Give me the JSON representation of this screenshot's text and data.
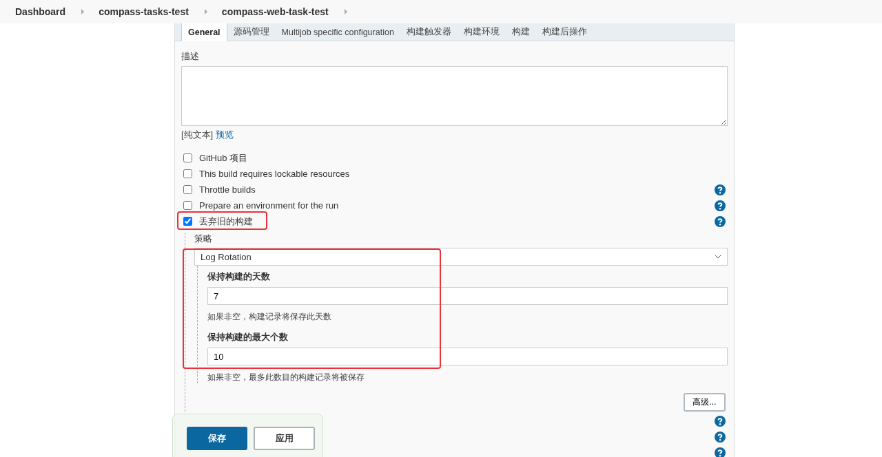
{
  "breadcrumb": [
    "Dashboard",
    "compass-tasks-test",
    "compass-web-task-test"
  ],
  "tabs": [
    {
      "label": "General",
      "selected": true
    },
    {
      "label": "源码管理",
      "selected": false
    },
    {
      "label": "Multijob specific configuration",
      "selected": false
    },
    {
      "label": "构建触发器",
      "selected": false
    },
    {
      "label": "构建环境",
      "selected": false
    },
    {
      "label": "构建",
      "selected": false
    },
    {
      "label": "构建后操作",
      "selected": false
    }
  ],
  "description": {
    "label": "描述"
  },
  "format": {
    "text": "[纯文本]",
    "link": "预览"
  },
  "options": [
    {
      "label": "GitHub 项目",
      "checked": false,
      "help": false,
      "highlighted": false
    },
    {
      "label": "This build requires lockable resources",
      "checked": false,
      "help": false,
      "highlighted": false
    },
    {
      "label": "Throttle builds",
      "checked": false,
      "help": true,
      "highlighted": false
    },
    {
      "label": "Prepare an environment for the run",
      "checked": false,
      "help": true,
      "highlighted": false
    },
    {
      "label": "丢弃旧的构建",
      "checked": true,
      "help": true,
      "highlighted": true
    }
  ],
  "strategy": {
    "label": "策略",
    "select": "Log Rotation",
    "highlighted": true,
    "fields": [
      {
        "label": "保持构建的天数",
        "value": "7",
        "hint": "如果非空，构建记录将保存此天数"
      },
      {
        "label": "保持构建的最大个数",
        "value": "10",
        "hint": "如果非空，最多此数目的构建记录将被保存"
      }
    ],
    "advanced": "高级..."
  },
  "later_options": [
    {
      "help": true
    },
    {
      "help": true
    },
    {
      "help": true
    }
  ],
  "actions": {
    "save": "保存",
    "apply": "应用"
  }
}
